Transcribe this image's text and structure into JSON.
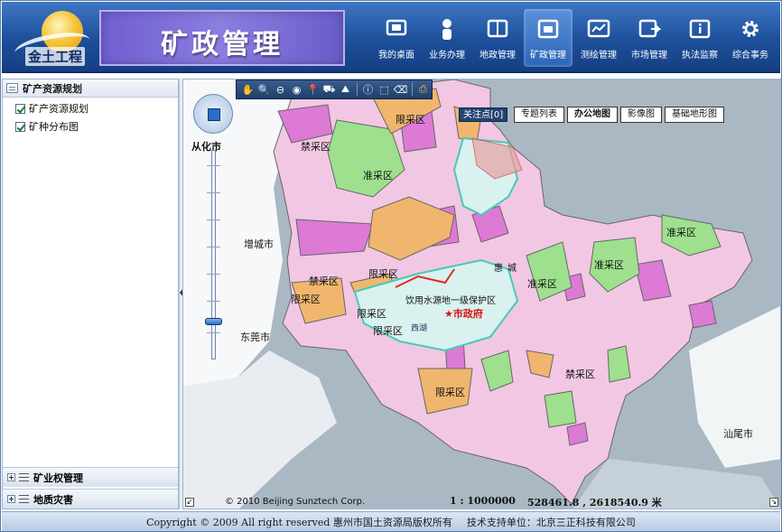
{
  "header": {
    "logo_text": "金土工程",
    "title": "矿政管理",
    "nav": [
      {
        "label": "我的桌面",
        "icon": "desktop-icon"
      },
      {
        "label": "业务办理",
        "icon": "user-icon"
      },
      {
        "label": "地政管理",
        "icon": "book-icon"
      },
      {
        "label": "矿政管理",
        "icon": "mine-icon"
      },
      {
        "label": "测绘管理",
        "icon": "chart-icon"
      },
      {
        "label": "市场管理",
        "icon": "export-icon"
      },
      {
        "label": "执法监察",
        "icon": "info-icon"
      },
      {
        "label": "综合事务",
        "icon": "gear-icon"
      }
    ]
  },
  "sidebar": {
    "panel_title": "矿产资源规划",
    "items": [
      {
        "label": "矿产资源规划",
        "checked": true
      },
      {
        "label": "矿种分布图",
        "checked": true
      }
    ],
    "collapsed": [
      "矿业权管理",
      "地质灾害"
    ]
  },
  "map": {
    "focus_label": "关注点[0]",
    "tabs": [
      {
        "label": "专题列表",
        "active": false
      },
      {
        "label": "办公地图",
        "active": true
      },
      {
        "label": "影像图",
        "active": false
      },
      {
        "label": "基础地形图",
        "active": false
      }
    ],
    "labels": {
      "conghua": "从化市",
      "zengcheng": "增城市",
      "dongguan": "东莞市",
      "shanwei": "汕尾市",
      "xiancai1": "限采区",
      "xiancai2": "限采区",
      "xiancai3": "限采区",
      "xiancai4": "限采区",
      "xiancai5": "限采区",
      "xiancai6": "限采区",
      "zhuncai1": "准采区",
      "zhuncai2": "准采区",
      "zhuncai3": "准采区",
      "zhuncai4": "准采区",
      "jincai1": "禁采区",
      "jincai2": "禁采区",
      "jincai3": "禁采区",
      "jincai4": "禁采区",
      "water": "饮用水源地一级保护区",
      "gov": "市政府",
      "xihu": "西湖",
      "hui": "惠",
      "cheng": "城"
    },
    "copyright": "© 2010 Beijing Sunztech Corp.",
    "scale": "1 : 1000000",
    "coords": "528461.8 , 2618540.9 米"
  },
  "footer": {
    "copyright": "Copyright © 2009 All right reserved 惠州市国土资源局版权所有",
    "support": "技术支持单位：北京三正科技有限公司"
  },
  "colors": {
    "pink": "#f2c7e3",
    "magenta": "#dc7ad6",
    "green": "#9ee08d",
    "orange": "#f0b66e",
    "water": "#aab8c4"
  }
}
